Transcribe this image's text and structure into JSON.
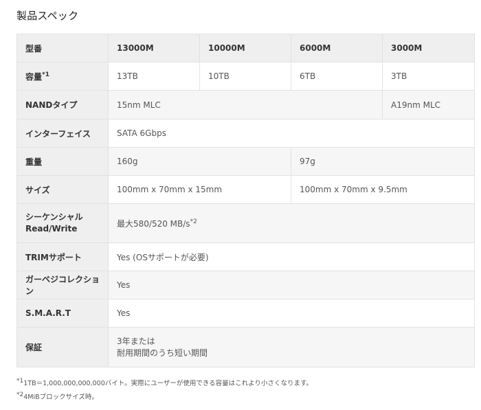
{
  "title": "製品スペック",
  "table": {
    "header": {
      "label": "型番",
      "models": [
        "13000M",
        "10000M",
        "6000M",
        "3000M"
      ]
    },
    "capacity": {
      "label": "容量",
      "note_mark": "*1",
      "values": [
        "13TB",
        "10TB",
        "6TB",
        "3TB"
      ]
    },
    "nand": {
      "label": "NANDタイプ",
      "values": [
        "15nm MLC",
        "A19nm MLC"
      ]
    },
    "interface": {
      "label": "インターフェイス",
      "value": "SATA 6Gbps"
    },
    "weight": {
      "label": "重量",
      "values": [
        "160g",
        "97g"
      ]
    },
    "size": {
      "label": "サイズ",
      "values": [
        "100mm x 70mm x 15mm",
        "100mm x 70mm x 9.5mm"
      ]
    },
    "sequential": {
      "label_line1": "シーケンシャル",
      "label_line2": "Read/Write",
      "value": "最大580/520 MB/s",
      "note_mark": "*2"
    },
    "trim": {
      "label": "TRIMサポート",
      "value": "Yes (OSサポートが必要)"
    },
    "gc": {
      "label": "ガーベジコレクション",
      "value": "Yes"
    },
    "smart": {
      "label": "S.M.A.R.T",
      "value": "Yes"
    },
    "warranty": {
      "label": "保証",
      "value_line1": "3年または",
      "value_line2": "耐用期間のうち短い期間"
    }
  },
  "notes": [
    {
      "mark": "*1",
      "text": "1TB＝1,000,000,000,000バイト。実際にユーザーが使用できる容量はこれより小さくなります。"
    },
    {
      "mark": "*2",
      "text": "4MiBブロックサイズ時。"
    }
  ]
}
